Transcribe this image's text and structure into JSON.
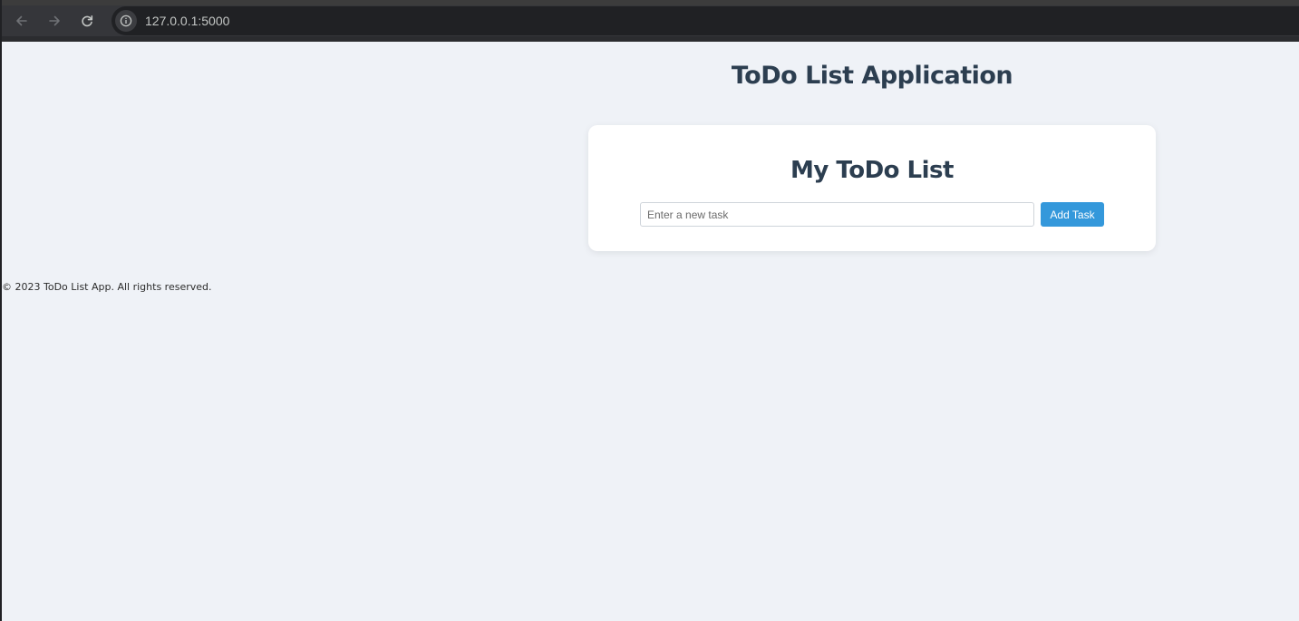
{
  "browser": {
    "url": "127.0.0.1:5000",
    "icons": {
      "back": "arrow-left-icon",
      "forward": "arrow-right-icon",
      "reload": "reload-icon",
      "site_info": "info-icon"
    }
  },
  "page": {
    "title": "ToDo List Application"
  },
  "todo_card": {
    "heading": "My ToDo List",
    "input": {
      "value": "",
      "placeholder": "Enter a new task"
    },
    "add_button_label": "Add Task"
  },
  "footer": {
    "text": "© 2023 ToDo List App. All rights reserved."
  },
  "colors": {
    "page_background": "#eff2f7",
    "heading_text": "#2c3e50",
    "button_accent": "#3498db",
    "card_background": "#ffffff"
  }
}
